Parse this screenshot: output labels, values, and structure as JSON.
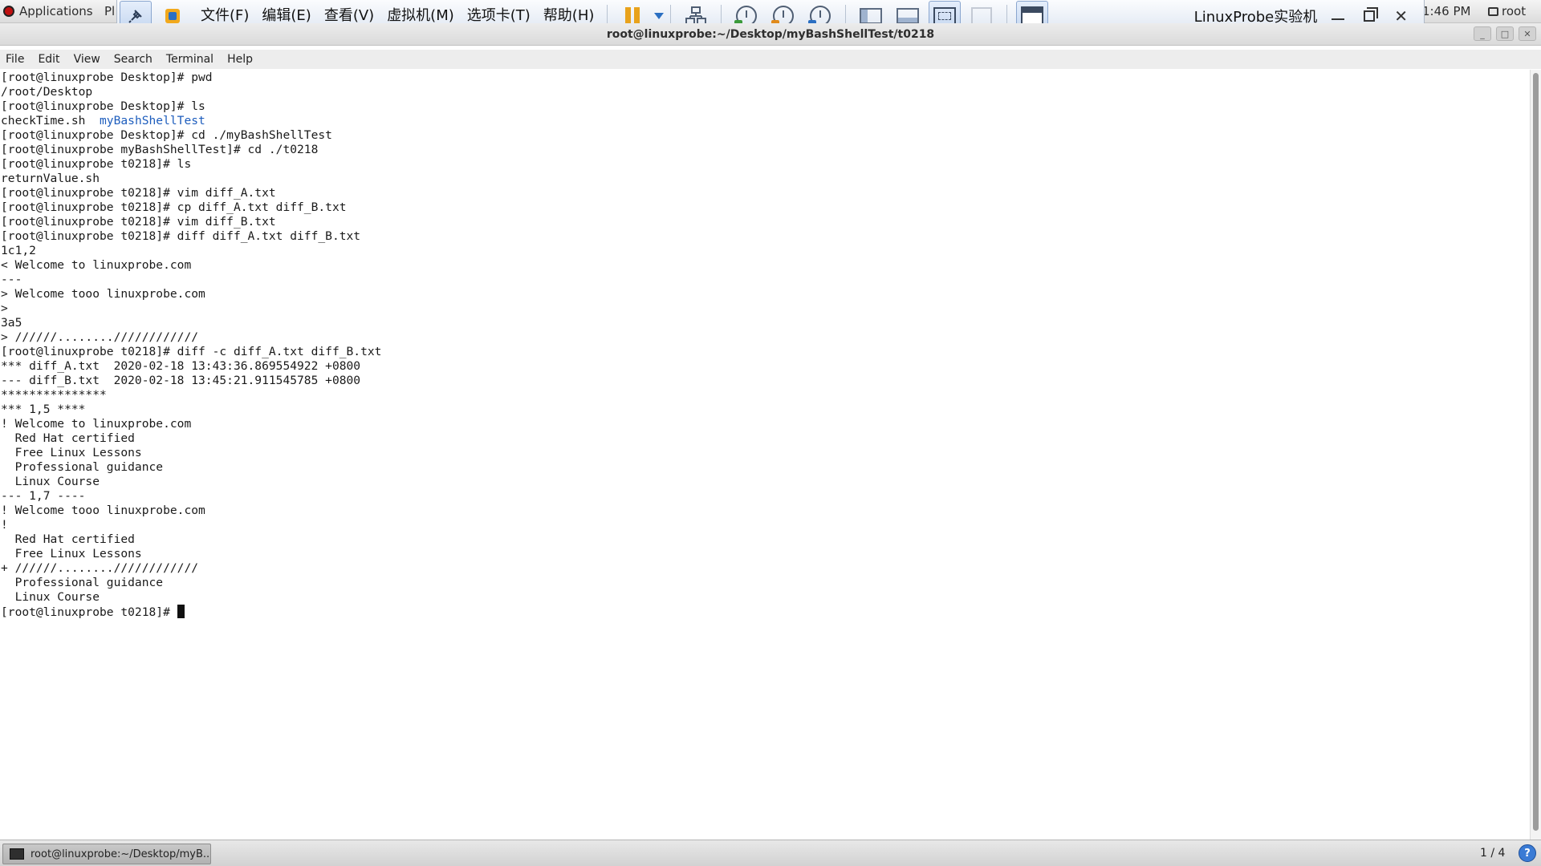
{
  "gnome": {
    "applications": "Applications",
    "places": "Pl",
    "clock": "1:46 PM",
    "user": "root"
  },
  "vmware": {
    "menu": [
      "文件(F)",
      "编辑(E)",
      "查看(V)",
      "虚拟机(M)",
      "选项卡(T)",
      "帮助(H)"
    ],
    "vm_title": "LinuxProbe实验机"
  },
  "terminal": {
    "window_title": "root@linuxprobe:~/Desktop/myBashShellTest/t0218",
    "menubar": [
      "File",
      "Edit",
      "View",
      "Search",
      "Terminal",
      "Help"
    ],
    "lines": [
      "[root@linuxprobe Desktop]# pwd",
      "/root/Desktop",
      "[root@linuxprobe Desktop]# ls",
      "checkTime.sh  ",
      "[root@linuxprobe Desktop]# cd ./myBashShellTest",
      "[root@linuxprobe myBashShellTest]# cd ./t0218",
      "[root@linuxprobe t0218]# ls",
      "returnValue.sh",
      "[root@linuxprobe t0218]# vim diff_A.txt",
      "[root@linuxprobe t0218]# cp diff_A.txt diff_B.txt",
      "[root@linuxprobe t0218]# vim diff_B.txt",
      "[root@linuxprobe t0218]# diff diff_A.txt diff_B.txt",
      "1c1,2",
      "< Welcome to linuxprobe.com",
      "---",
      "> Welcome tooo linuxprobe.com",
      ">",
      "3a5",
      "> //////........////////////",
      "[root@linuxprobe t0218]# diff -c diff_A.txt diff_B.txt",
      "*** diff_A.txt  2020-02-18 13:43:36.869554922 +0800",
      "--- diff_B.txt  2020-02-18 13:45:21.911545785 +0800",
      "***************",
      "*** 1,5 ****",
      "! Welcome to linuxprobe.com",
      "  Red Hat certified",
      "  Free Linux Lessons",
      "  Professional guidance",
      "  Linux Course",
      "--- 1,7 ----",
      "! Welcome tooo linuxprobe.com",
      "!",
      "  Red Hat certified",
      "  Free Linux Lessons",
      "+ //////........////////////",
      "  Professional guidance",
      "  Linux Course",
      "[root@linuxprobe t0218]# "
    ],
    "ls_dir": "myBashShellTest",
    "dir_color": "#1d5dbd"
  },
  "taskbar": {
    "task_label": "root@linuxprobe:~/Desktop/myB...",
    "workspace": "1 / 4",
    "help": "?"
  }
}
